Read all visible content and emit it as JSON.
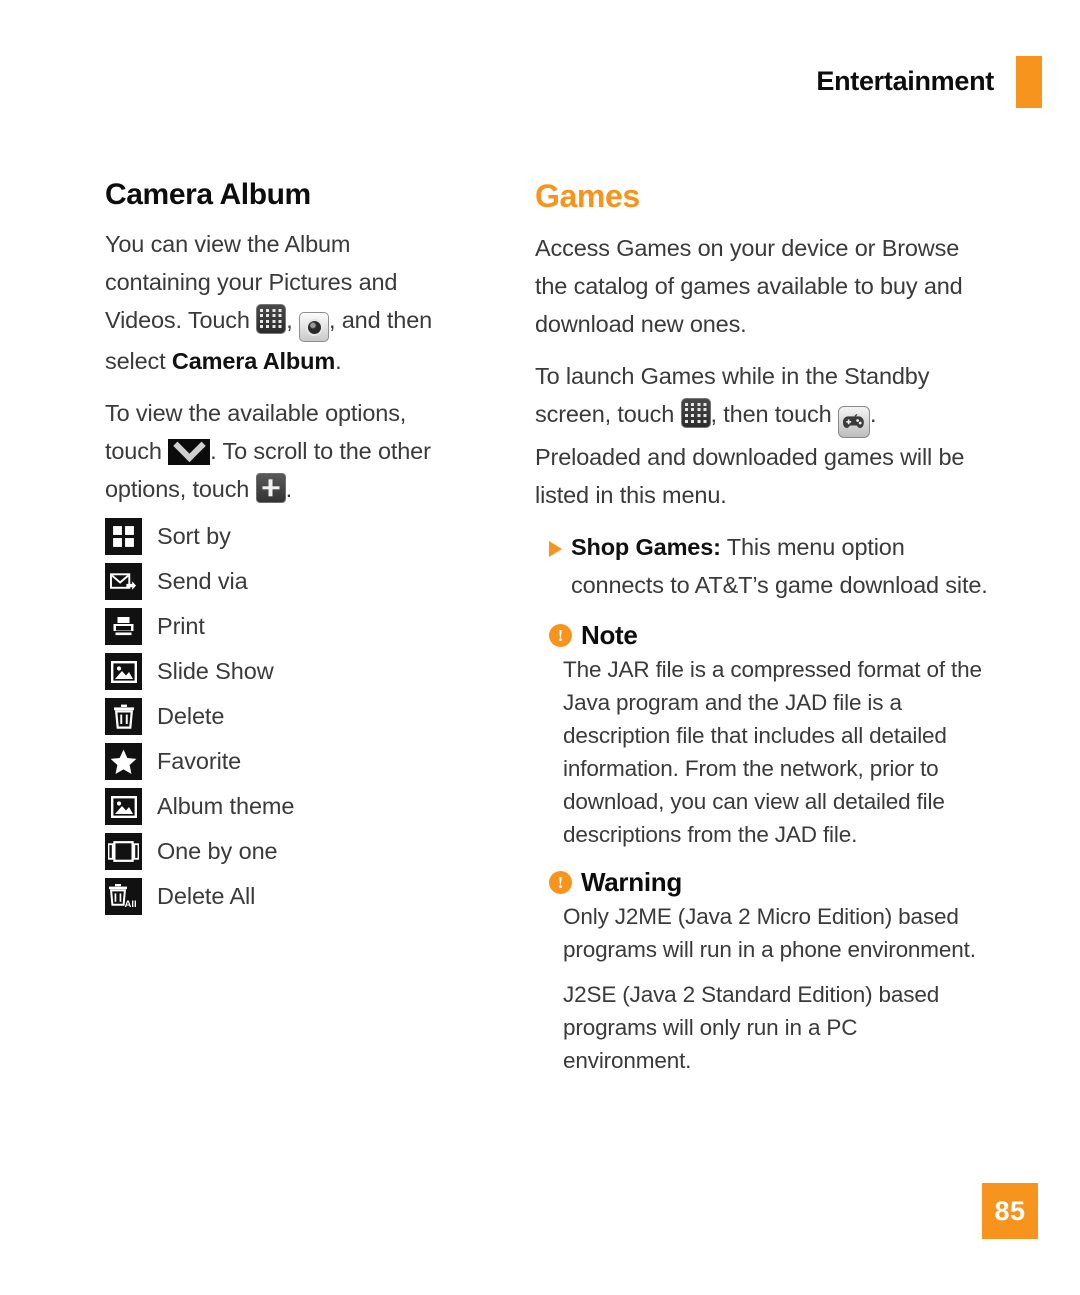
{
  "header": {
    "title": "Entertainment",
    "accent_color": "#F7941E"
  },
  "left_column": {
    "section_title": "Camera Album",
    "paragraph1": {
      "part1": "You can view the Album containing your Pictures and Videos. Touch",
      "icon1": "grid-menu-icon",
      "separator1": ",",
      "icon2": "camera-icon",
      "part2": ", and then select",
      "bold": "Camera Album",
      "part3": "."
    },
    "paragraph2": {
      "part1": "To view the available options, touch",
      "icon1": "chevron-down-icon",
      "part2": ". To scroll to the other options, touch",
      "icon2": "plus-icon",
      "part3": "."
    },
    "options": [
      {
        "label": "Sort by",
        "icon": "sort-by-icon"
      },
      {
        "label": "Send via",
        "icon": "send-via-icon"
      },
      {
        "label": "Print",
        "icon": "print-icon"
      },
      {
        "label": "Slide Show",
        "icon": "slide-show-icon"
      },
      {
        "label": "Delete",
        "icon": "delete-icon"
      },
      {
        "label": "Favorite",
        "icon": "favorite-star-icon"
      },
      {
        "label": "Album theme",
        "icon": "album-theme-icon"
      },
      {
        "label": "One by one",
        "icon": "one-by-one-icon"
      },
      {
        "label": "Delete All",
        "icon": "delete-all-icon"
      }
    ]
  },
  "right_column": {
    "section_title": "Games",
    "paragraph1": "Access Games on your device or Browse the catalog of games available to buy and download new ones.",
    "paragraph2": {
      "part1": "To launch Games while in the Standby screen, touch",
      "icon1": "grid-menu-icon",
      "part2": ", then touch",
      "icon2": "gamepad-icon",
      "part3": ". Preloaded and downloaded games will be listed in this menu."
    },
    "bullet": {
      "marker": "triangle-bullet-icon",
      "bold": "Shop Games:",
      "text": " This menu option connects to AT&T’s game download site."
    },
    "note": {
      "badge": "!",
      "badge_icon": "exclamation-circle-icon",
      "title": "Note",
      "body": "The JAR file is a compressed format of the Java program and the JAD file is a description file that includes all detailed information. From the network, prior to download, you can view all detailed file descriptions from the JAD file."
    },
    "warning": {
      "badge": "!",
      "badge_icon": "exclamation-circle-icon",
      "title": "Warning",
      "body1": "Only J2ME (Java 2 Micro Edition) based programs will run in a phone environment.",
      "body2": "J2SE (Java 2 Standard Edition) based programs will only run in a PC environment."
    }
  },
  "footer": {
    "page_number": "85"
  }
}
